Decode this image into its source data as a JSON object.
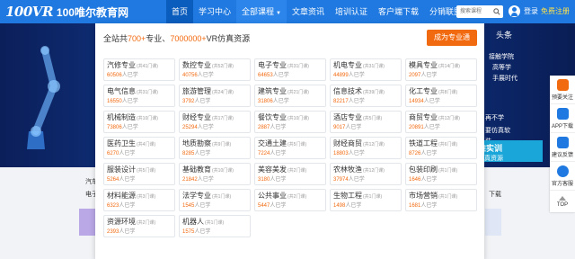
{
  "header": {
    "logo_mark": "100VR",
    "logo_text": "100唯尔教育网",
    "nav": [
      {
        "label": "首页"
      },
      {
        "label": "学习中心"
      },
      {
        "label": "全部课程"
      },
      {
        "label": "文章资讯"
      },
      {
        "label": "培训认证"
      },
      {
        "label": "客户端下载"
      },
      {
        "label": "分销联盟"
      }
    ],
    "search_placeholder": "搜索课程",
    "login": "登录",
    "register": "免费注册"
  },
  "banner": {
    "right_lines": [
      "头条",
      "，",
      "接触学院",
      "高等学",
      "手展时代",
      "，",
      "，",
      "再不学",
      "要仿真软",
      "装"
    ],
    "sim_title": "难实训",
    "sim_sub": "仿真资源",
    "page_texts": [
      "汽车",
      "电子",
      "下载"
    ]
  },
  "floatbar": {
    "items": [
      {
        "label": "预要关注",
        "icon": "qrcode-icon",
        "color": "#f26a10"
      },
      {
        "label": "APP下载",
        "icon": "app-icon",
        "color": "#1f79e0"
      },
      {
        "label": "建议反馈",
        "icon": "feedback-icon",
        "color": "#1f79e0"
      },
      {
        "label": "官方客服",
        "icon": "service-icon",
        "color": "#1f79e0"
      }
    ],
    "top_label": "TOP"
  },
  "panel": {
    "head_prefix": "全站共",
    "majors_count": "700+",
    "head_mid": "专业、",
    "resources_count": "7000000+",
    "head_suffix": "VR仿真资源",
    "cta_label": "成为专业通",
    "learn_suffix": "人已学",
    "cards": [
      {
        "name": "汽修专业",
        "count": "(共41门课)",
        "learners": "60506"
      },
      {
        "name": "数控专业",
        "count": "(共52门课)",
        "learners": "40756"
      },
      {
        "name": "电子专业",
        "count": "(共31门课)",
        "learners": "64653"
      },
      {
        "name": "机电专业",
        "count": "(共31门课)",
        "learners": "44899"
      },
      {
        "name": "模具专业",
        "count": "(共14门课)",
        "learners": "2097"
      },
      {
        "name": "电气信息",
        "count": "(共31门课)",
        "learners": "16550"
      },
      {
        "name": "旅游管理",
        "count": "(共24门课)",
        "learners": "3792"
      },
      {
        "name": "建筑专业",
        "count": "(共21门课)",
        "learners": "31806"
      },
      {
        "name": "信息技术",
        "count": "(共39门课)",
        "learners": "82217"
      },
      {
        "name": "化工专业",
        "count": "(共8门课)",
        "learners": "14934"
      },
      {
        "name": "机械制造",
        "count": "(共10门课)",
        "learners": "73806"
      },
      {
        "name": "财经专业",
        "count": "(共17门课)",
        "learners": "25294"
      },
      {
        "name": "餐饮专业",
        "count": "(共10门课)",
        "learners": "2887"
      },
      {
        "name": "酒店专业",
        "count": "(共5门课)",
        "learners": "9017"
      },
      {
        "name": "商贸专业",
        "count": "(共12门课)",
        "learners": "20891"
      },
      {
        "name": "医药卫生",
        "count": "(共4门课)",
        "learners": "6270"
      },
      {
        "name": "地质勘察",
        "count": "(共9门课)",
        "learners": "8285"
      },
      {
        "name": "交通土建",
        "count": "(共5门课)",
        "learners": "7224"
      },
      {
        "name": "财经商贸",
        "count": "(共12门课)",
        "learners": "18803"
      },
      {
        "name": "铁道工程",
        "count": "(共6门课)",
        "learners": "8726"
      },
      {
        "name": "服装设计",
        "count": "(共5门课)",
        "learners": "5264"
      },
      {
        "name": "基础教育",
        "count": "(共10门课)",
        "learners": "21842"
      },
      {
        "name": "美容美发",
        "count": "(共2门课)",
        "learners": "3180"
      },
      {
        "name": "农林牧渔",
        "count": "(共12门课)",
        "learners": "37974"
      },
      {
        "name": "包装印刷",
        "count": "(共1门课)",
        "learners": "1646"
      },
      {
        "name": "材料能源",
        "count": "(共3门课)",
        "learners": "6323"
      },
      {
        "name": "法学专业",
        "count": "(共1门课)",
        "learners": "1545"
      },
      {
        "name": "公共事业",
        "count": "(共2门课)",
        "learners": "5447"
      },
      {
        "name": "生物工程",
        "count": "(共1门课)",
        "learners": "1498"
      },
      {
        "name": "市场营销",
        "count": "(共1门课)",
        "learners": "1681"
      },
      {
        "name": "资源环境",
        "count": "(共2门课)",
        "learners": "2393"
      },
      {
        "name": "机器人",
        "count": "(共1门课)",
        "learners": "1575"
      }
    ]
  }
}
